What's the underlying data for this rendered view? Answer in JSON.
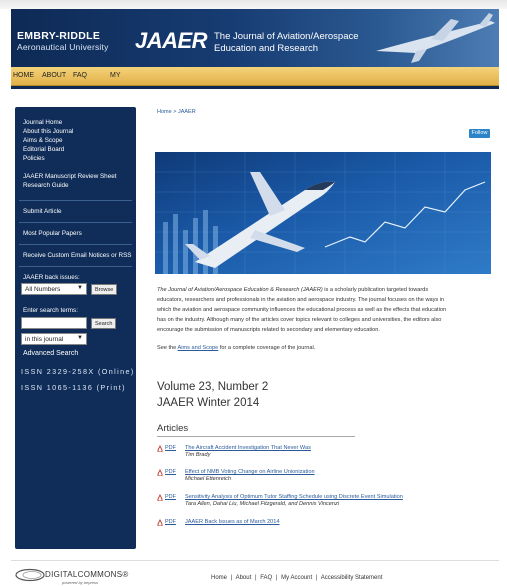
{
  "header": {
    "university_line1": "EMBRY-RIDDLE",
    "university_line2": "Aeronautical University",
    "journal_logo": "JAAER",
    "journal_title_line1": "The Journal of Aviation/Aerospace",
    "journal_title_line2": "Education and Research"
  },
  "nav": {
    "home": "HOME",
    "about": "ABOUT",
    "faq": "FAQ",
    "my": "MY"
  },
  "sidebar": {
    "links_group1": [
      "Journal Home",
      "About this Journal",
      "Aims & Scope",
      "Editorial Board",
      "Policies"
    ],
    "links_group2": [
      "JAAER Manuscript Review Sheet",
      "Research Guide"
    ],
    "submit": "Submit Article",
    "popular": "Most Popular Papers",
    "notices": "Receive Custom Email Notices or RSS",
    "back_issues_label": "JAAER back issues:",
    "back_issues_select": "All Numbers",
    "browse_button": "Browse",
    "search_label": "Enter search terms:",
    "search_button": "Search",
    "search_scope": "in this journal",
    "advanced_search": "Advanced Search",
    "issn_online": "ISSN 2329-258X (Online)",
    "issn_print": "ISSN 1065-1136 (Print)"
  },
  "breadcrumb": "Home > JAAER",
  "follow_label": "Follow",
  "description": {
    "journal_name": "The Journal of Aviation/Aerospace Education & Research (JAAER)",
    "body_line1": " is a scholarly publication targeted towards",
    "line2": "educators, researchers and professionals in the aviation and aerospace industry. The journal focuses on the ways in",
    "line3": "which the aviation and aerospace community influences the educational process as well as the effects that education",
    "line4": "has on the industry. Although many of the articles cover topics relevant to colleges and universities, the editors also",
    "line5": "encourage the submission of manuscripts related to secondary and elementary education.",
    "see_prefix": "See the ",
    "see_link": "Aims and Scope",
    "see_suffix": " for a complete coverage of the journal."
  },
  "issue": {
    "volume": "Volume 23, Number 2",
    "title": "JAAER Winter 2014"
  },
  "articles_heading": "Articles",
  "pdf_label": "PDF",
  "articles": [
    {
      "title": "The Aircraft Accident Investigation That Never Was",
      "authors": "Tim Brady"
    },
    {
      "title": "Effect of NMB Voting Change on Airline Unionization",
      "authors": "Michael Ettenreich"
    },
    {
      "title": "Sensitivity Analysis of Optimum Tutor Staffing Schedule using Discrete Event Simulation",
      "authors": "Tara Allen, Dahai Liu, Michael Fitzgerald, and Dennis Vincenzi"
    },
    {
      "title": "JAAER Back Issues as of March 2014",
      "authors": ""
    }
  ],
  "footer": {
    "brand": "DIGITALCOMMONS®",
    "brand_sub": "powered by bepress",
    "links": [
      "Home",
      "About",
      "FAQ",
      "My Account",
      "Accessibility Statement"
    ],
    "separator": "|"
  },
  "colors": {
    "sidebar_bg": "#0f2d58",
    "nav_gold": "#e2b048",
    "link_blue": "#2a5a9a",
    "follow_blue": "#2c83c8",
    "pdf_red": "#c0392b"
  }
}
